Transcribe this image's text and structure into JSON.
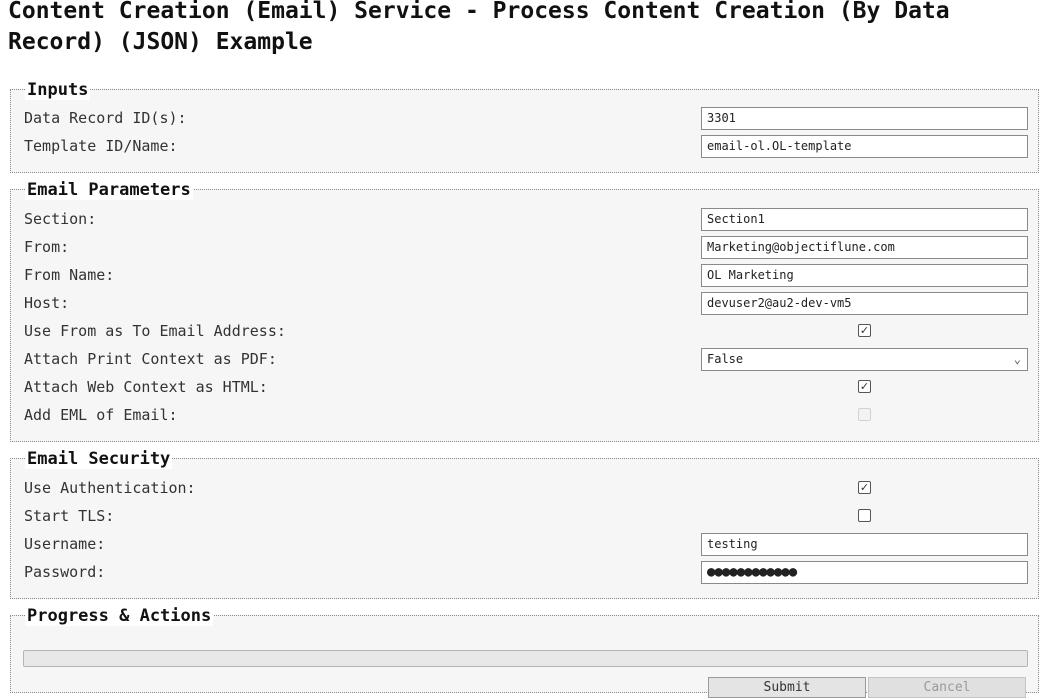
{
  "page_title": "Content Creation (Email) Service - Process Content Creation (By Data Record) (JSON) Example",
  "inputs": {
    "legend": "Inputs",
    "data_record_label": "Data Record ID(s):",
    "data_record_value": "3301",
    "template_label": "Template ID/Name:",
    "template_value": "email-ol.OL-template"
  },
  "email_parameters": {
    "legend": "Email Parameters",
    "section_label": "Section:",
    "section_value": "Section1",
    "from_label": "From:",
    "from_value": "Marketing@objectiflune.com",
    "from_name_label": "From Name:",
    "from_name_value": "OL Marketing",
    "host_label": "Host:",
    "host_value": "devuser2@au2-dev-vm5",
    "use_from_label": "Use From as To Email Address:",
    "use_from_checked": true,
    "attach_print_label": "Attach Print Context as PDF:",
    "attach_print_value": "False",
    "attach_web_label": "Attach Web Context as HTML:",
    "attach_web_checked": true,
    "add_eml_label": "Add EML of Email:",
    "add_eml_checked": false
  },
  "email_security": {
    "legend": "Email Security",
    "use_auth_label": "Use Authentication:",
    "use_auth_checked": true,
    "start_tls_label": "Start TLS:",
    "start_tls_checked": false,
    "username_label": "Username:",
    "username_value": "testing",
    "password_label": "Password:",
    "password_masked": "●●●●●●●●●●●●"
  },
  "progress_actions": {
    "legend": "Progress & Actions",
    "progress_percent": 0,
    "submit_label": "Submit",
    "cancel_label": "Cancel"
  },
  "icons": {
    "checkmark": "✓",
    "chevron": "⌄"
  }
}
